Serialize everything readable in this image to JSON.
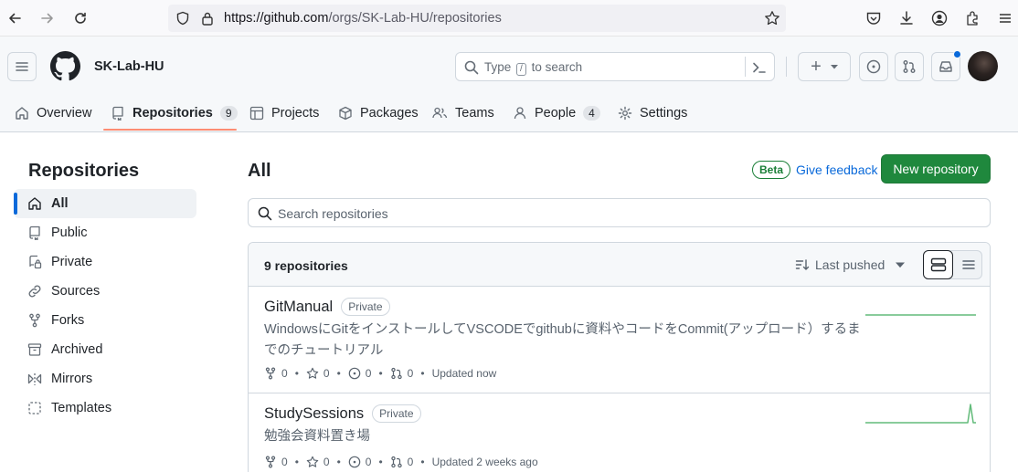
{
  "browser": {
    "url_host": "https://github.com",
    "url_path": "/orgs/SK-Lab-HU/repositories"
  },
  "header": {
    "org_name": "SK-Lab-HU",
    "search_text": "Type",
    "search_key": "/",
    "search_suffix": "to search",
    "new_label": "+"
  },
  "tabs": [
    {
      "label": "Overview"
    },
    {
      "label": "Repositories",
      "count": "9"
    },
    {
      "label": "Projects"
    },
    {
      "label": "Packages"
    },
    {
      "label": "Teams"
    },
    {
      "label": "People",
      "count": "4"
    },
    {
      "label": "Settings"
    }
  ],
  "sidebar": {
    "title": "Repositories",
    "items": [
      {
        "label": "All"
      },
      {
        "label": "Public"
      },
      {
        "label": "Private"
      },
      {
        "label": "Sources"
      },
      {
        "label": "Forks"
      },
      {
        "label": "Archived"
      },
      {
        "label": "Mirrors"
      },
      {
        "label": "Templates"
      }
    ]
  },
  "main": {
    "title": "All",
    "beta": "Beta",
    "feedback": "Give feedback",
    "new_repo": "New repository",
    "search_placeholder": "Search repositories",
    "count_label": "9 repositories",
    "sort_label": "Last pushed"
  },
  "repos": [
    {
      "name": "GitManual",
      "badge": "Private",
      "description": "WindowsにGitをインストールしてVSCODEでgithubに資料やコードをCommit(アップロード）するまでのチュートリアル",
      "forks": "0",
      "stars": "0",
      "issues": "0",
      "prs": "0",
      "updated": "Updated now"
    },
    {
      "name": "StudySessions",
      "badge": "Private",
      "description": "勉強会資料置き場",
      "forks": "0",
      "stars": "0",
      "issues": "0",
      "prs": "0",
      "updated": "Updated 2 weeks ago"
    }
  ],
  "colors": {
    "accent": "#0969da",
    "tab_underline": "#fd8c73",
    "new_repo_bg": "#1f883d",
    "sparkline": "#2da44e"
  }
}
